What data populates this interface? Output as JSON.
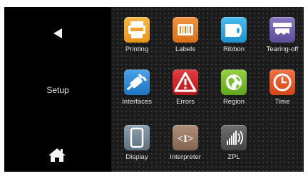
{
  "sidebar": {
    "back_icon": "back-triangle-icon",
    "title": "Setup",
    "home_icon": "home-icon"
  },
  "menu": {
    "items": [
      {
        "label": "Printing",
        "icon": "printing-icon",
        "color": "#f0a32a"
      },
      {
        "label": "Labels",
        "icon": "labels-icon",
        "color": "#e57d1c"
      },
      {
        "label": "Ribbon",
        "icon": "ribbon-icon",
        "color": "#29a7e1"
      },
      {
        "label": "Tearing-off",
        "icon": "tearing-off-icon",
        "color": "#6f5dab"
      },
      {
        "label": "Interfaces",
        "icon": "interfaces-icon",
        "color": "#2b8ad8"
      },
      {
        "label": "Errors",
        "icon": "errors-icon",
        "color": "#d8232a"
      },
      {
        "label": "Region",
        "icon": "region-icon",
        "color": "#7cbf2d"
      },
      {
        "label": "Time",
        "icon": "time-icon",
        "color": "#ea5a24"
      },
      {
        "label": "Display",
        "icon": "display-icon",
        "color": "#6f8594"
      },
      {
        "label": "Interpreter",
        "icon": "interpreter-icon",
        "color": "#9a7a66"
      },
      {
        "label": "ZPL",
        "icon": "zpl-icon",
        "color": "#5a5a5a"
      }
    ]
  }
}
